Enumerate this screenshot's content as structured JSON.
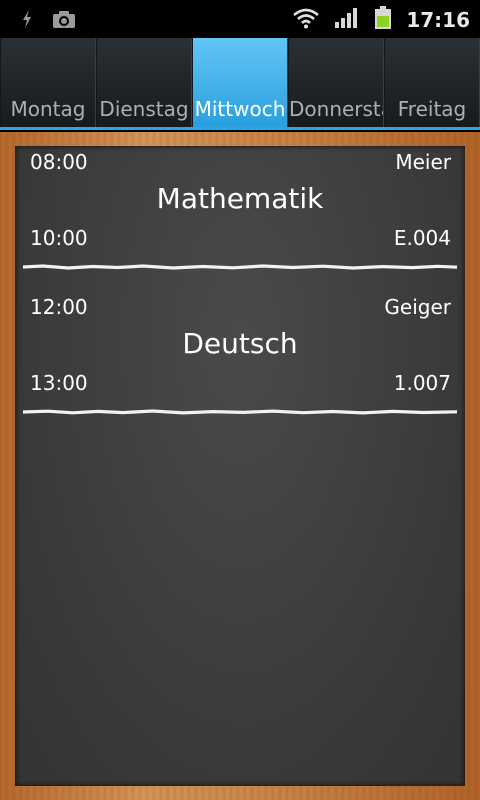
{
  "status_bar": {
    "time": "17:16",
    "icons": [
      "usb-debug-icon",
      "camera-icon",
      "wifi-icon",
      "signal-icon",
      "battery-icon"
    ]
  },
  "tabs": [
    {
      "label": "Montag",
      "active": false
    },
    {
      "label": "Dienstag",
      "active": false
    },
    {
      "label": "Mittwoch",
      "active": true
    },
    {
      "label": "Donnersta",
      "active": false
    },
    {
      "label": "Freitag",
      "active": false
    }
  ],
  "lessons": [
    {
      "start": "08:00",
      "teacher": "Meier",
      "subject": "Mathematik",
      "end": "10:00",
      "room": "E.004"
    },
    {
      "start": "12:00",
      "teacher": "Geiger",
      "subject": "Deutsch",
      "end": "13:00",
      "room": "1.007"
    }
  ],
  "colors": {
    "accent": "#2aa6e6",
    "board": "#3d3d3d",
    "frame": "#c98546",
    "battery": "#8fd11c"
  }
}
